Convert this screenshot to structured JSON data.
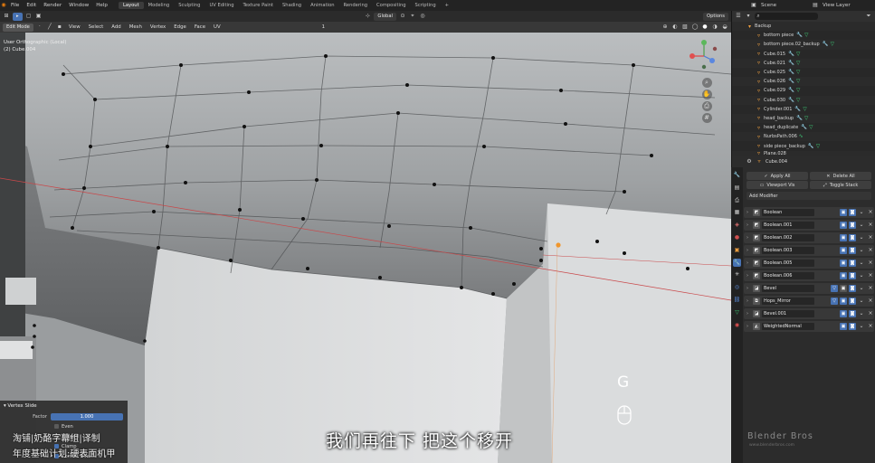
{
  "topbar": {
    "menus": [
      "File",
      "Edit",
      "Render",
      "Window",
      "Help"
    ],
    "workspaces": [
      "Layout",
      "Modeling",
      "Sculpting",
      "UV Editing",
      "Texture Paint",
      "Shading",
      "Animation",
      "Rendering",
      "Compositing",
      "Scripting"
    ],
    "active_workspace": "Layout",
    "scene": "Scene",
    "view_layer": "View Layer"
  },
  "viewport": {
    "mode": "Edit Mode",
    "menus": [
      "View",
      "Select",
      "Add",
      "Mesh",
      "Vertex",
      "Edge",
      "Face",
      "UV"
    ],
    "orientation": "Global",
    "options": "Options",
    "header_value": "1",
    "view_name": "User Orthographic (Local)",
    "object_info": "(2) Cube.004"
  },
  "operator_panel": {
    "title": "Vertex Slide",
    "factor_label": "Factor",
    "factor_value": "1.000",
    "even": "Even",
    "flipped": "Flipped",
    "clamp": "Clamp",
    "correct_uvs": "Correct UVs"
  },
  "overlay": {
    "key": "G",
    "subtitle": "我们再往下 把这个移开",
    "watermark_line1": "淘铺|奶酪字幕组|译制",
    "watermark_line2": "年度基础计划:硬表面机甲",
    "brand": "Blender Bros",
    "brand_url": "www.blenderbros.com"
  },
  "outliner": {
    "items": [
      {
        "name": "Backup"
      },
      {
        "name": "bottom piece"
      },
      {
        "name": "bottom piece.02_backup"
      },
      {
        "name": "Cube.015"
      },
      {
        "name": "Cube.021"
      },
      {
        "name": "Cube.025"
      },
      {
        "name": "Cube.026"
      },
      {
        "name": "Cube.029"
      },
      {
        "name": "Cube.030"
      },
      {
        "name": "Cylinder.001"
      },
      {
        "name": "head_backup"
      },
      {
        "name": "head_duplicate"
      },
      {
        "name": "NurbsPath.006"
      },
      {
        "name": "side piece_backup"
      },
      {
        "name": "Plane.028"
      }
    ]
  },
  "properties": {
    "object": "Cube.004",
    "apply_all": "Apply All",
    "delete_all": "Delete All",
    "viewport_vis": "Viewport Vis",
    "toggle_stack": "Toggle Stack",
    "add_modifier": "Add Modifier",
    "modifiers": [
      {
        "name": "Boolean"
      },
      {
        "name": "Boolean.001"
      },
      {
        "name": "Boolean.002"
      },
      {
        "name": "Boolean.003"
      },
      {
        "name": "Boolean.005"
      },
      {
        "name": "Boolean.006"
      },
      {
        "name": "Bevel"
      },
      {
        "name": "Hops_Mirror"
      },
      {
        "name": "Bevel.001"
      },
      {
        "name": "WeightedNormal"
      }
    ]
  }
}
